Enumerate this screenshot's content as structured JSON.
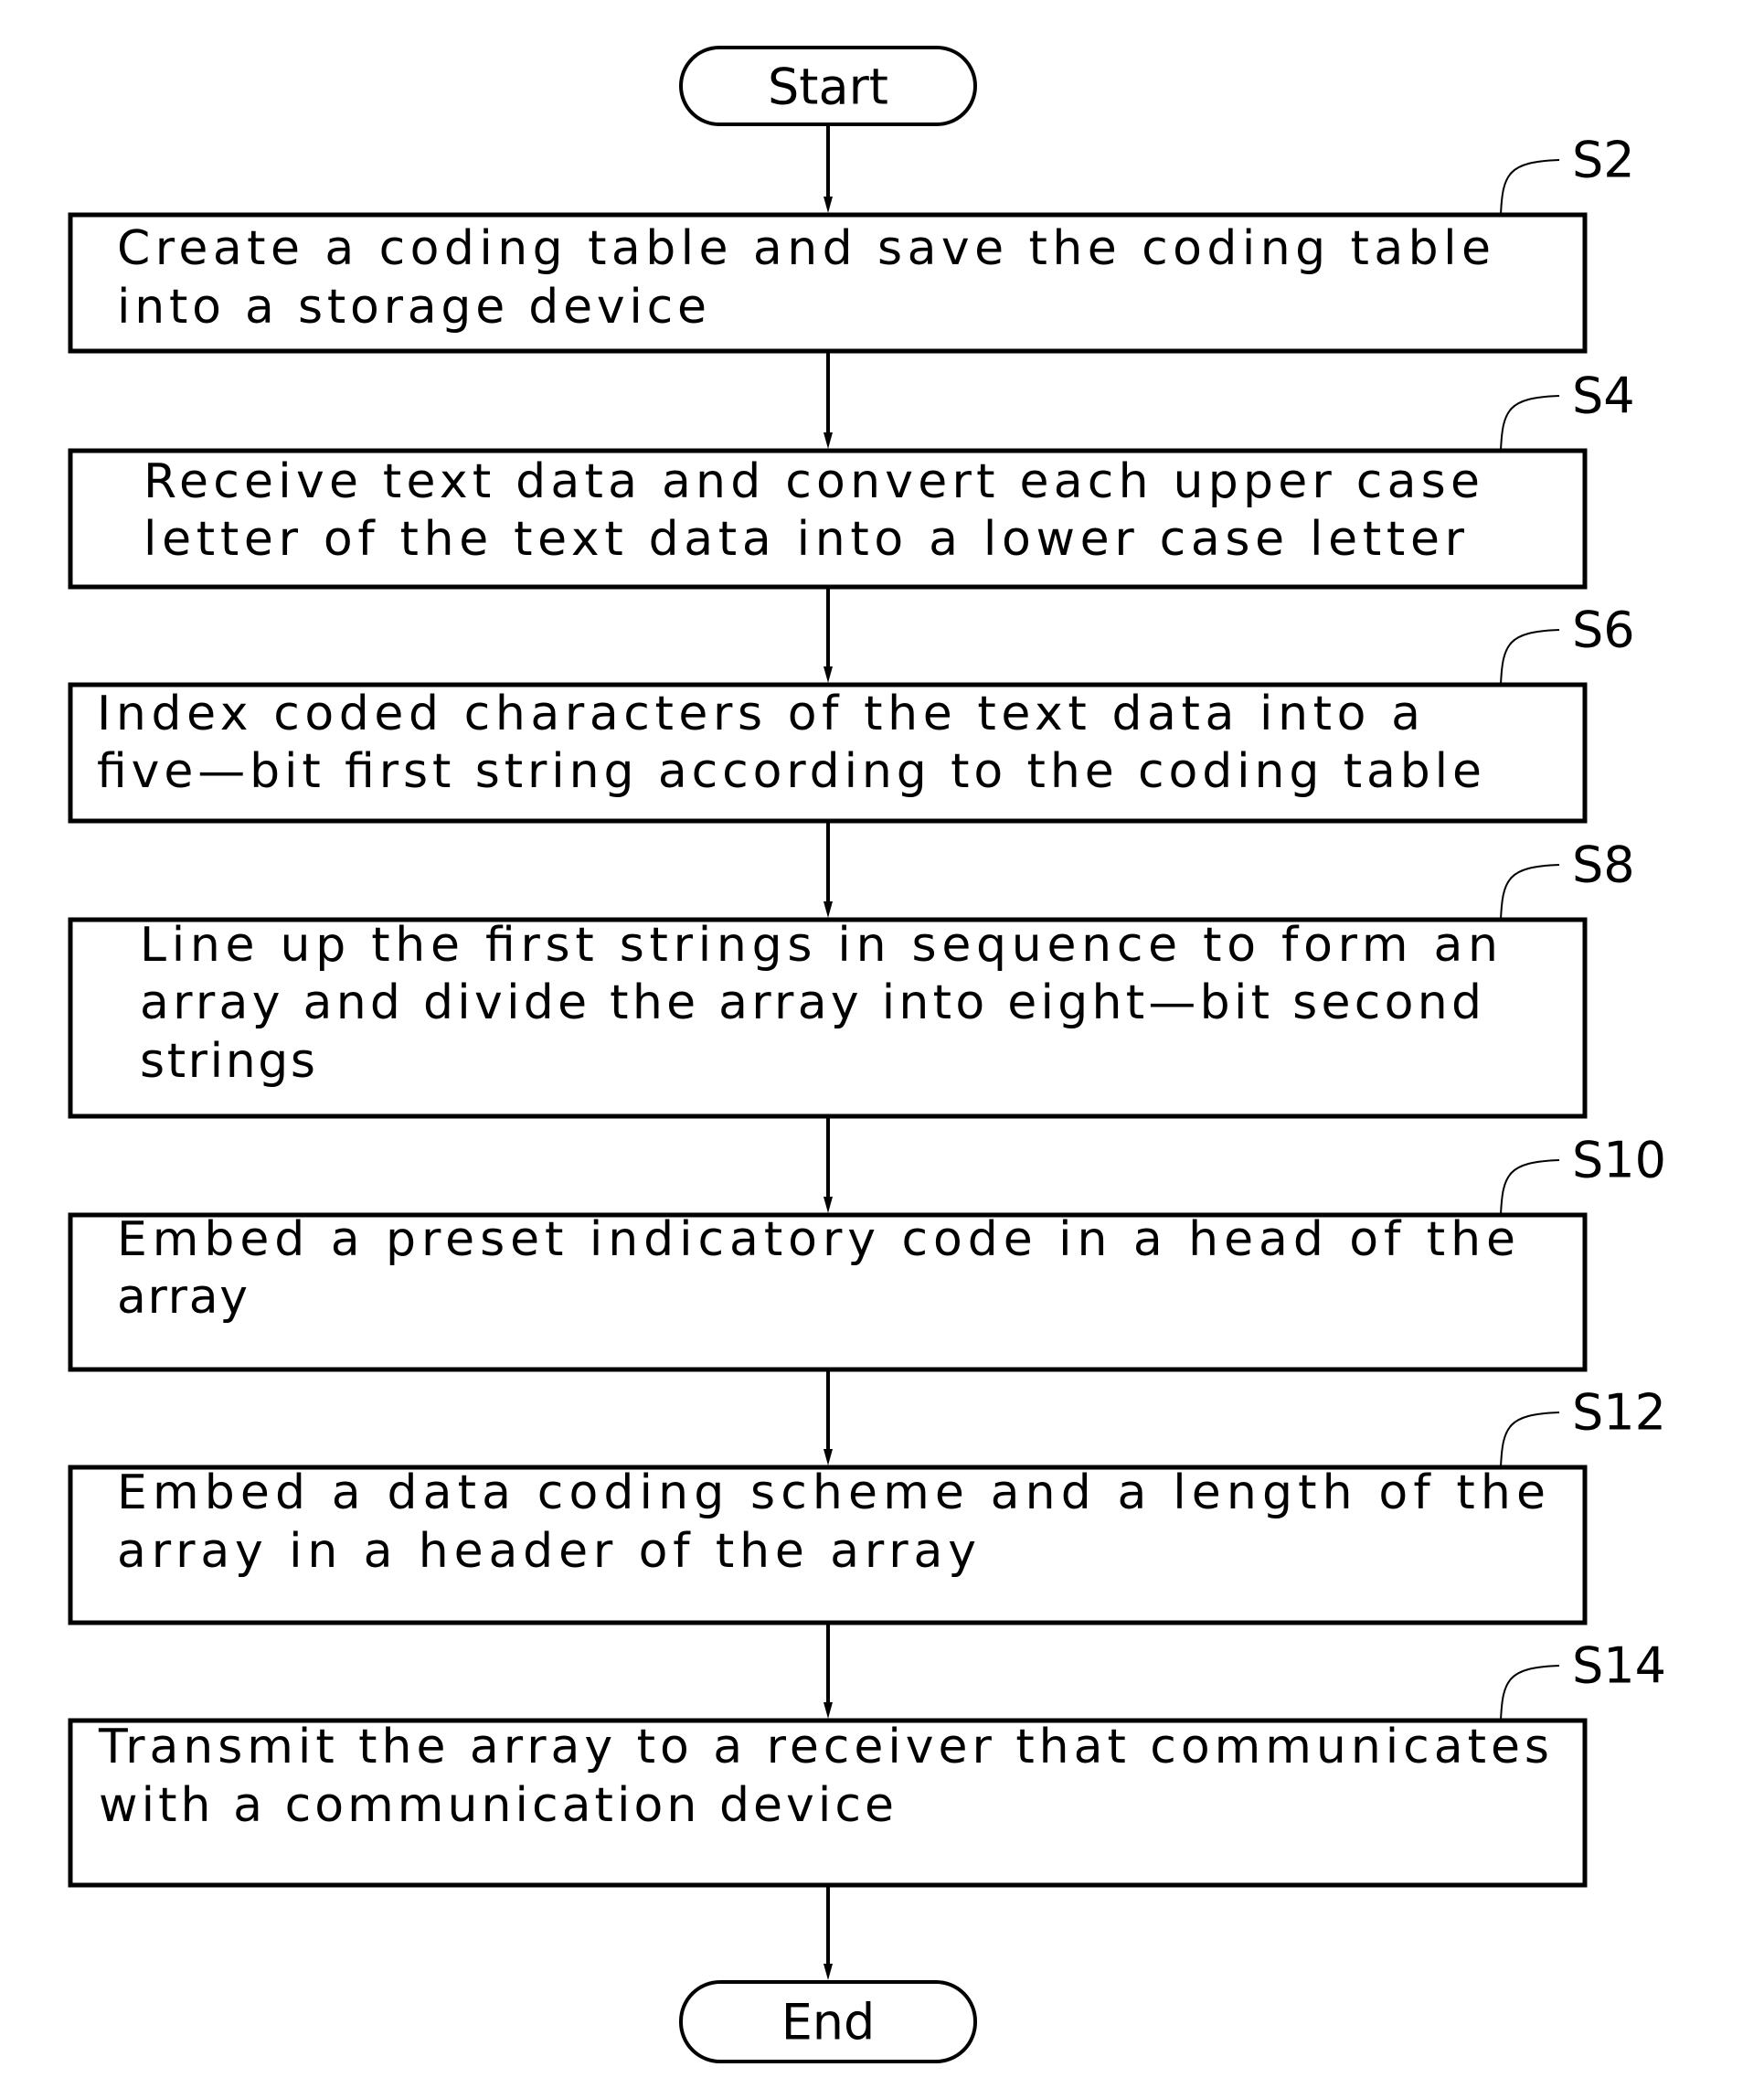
{
  "diagram": {
    "type": "flowchart",
    "start_label": "Start",
    "end_label": "End",
    "steps": [
      {
        "id": "S2",
        "lines": [
          "Create a coding table and save the coding table",
          "into a storage device"
        ]
      },
      {
        "id": "S4",
        "lines": [
          "Receive text data and convert each upper case",
          "letter of the text data into a lower case letter"
        ]
      },
      {
        "id": "S6",
        "lines": [
          "Index coded characters of the text data into a",
          "five—bit first string according to the coding table"
        ]
      },
      {
        "id": "S8",
        "lines": [
          "Line up the first strings in sequence to form an",
          "array and divide the array into eight—bit second",
          "strings"
        ]
      },
      {
        "id": "S10",
        "lines": [
          "Embed a preset indicatory code in a head of the",
          "array"
        ]
      },
      {
        "id": "S12",
        "lines": [
          "Embed a data coding scheme and a length of the",
          "array in a header of the array"
        ]
      },
      {
        "id": "S14",
        "lines": [
          "Transmit the array to a receiver that communicates",
          "with a communication device"
        ]
      }
    ]
  }
}
